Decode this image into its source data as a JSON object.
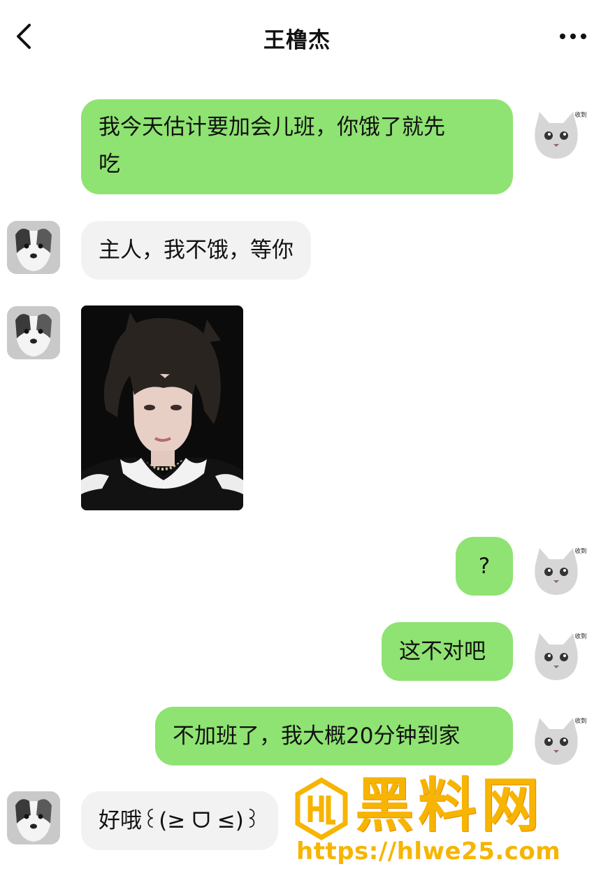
{
  "header": {
    "title": "王橹杰",
    "back_icon": "chevron-left-icon",
    "more_icon": "more-dots-icon"
  },
  "messages": [
    {
      "sender": "me",
      "text": "我今天估计要加会儿班，你饿了就先\n吃"
    },
    {
      "sender": "other",
      "text": "主人，我不饿，等你"
    },
    {
      "sender": "other",
      "type": "image"
    },
    {
      "sender": "me",
      "text": "?"
    },
    {
      "sender": "me",
      "text": "这不对吧"
    },
    {
      "sender": "me",
      "text": "不加班了，我大概20分钟到家"
    },
    {
      "sender": "other",
      "text": "好哦꒰(≥ ᗜ ≤)꒱"
    }
  ],
  "avatars": {
    "me_tag": "收到",
    "me_icon": "cat-avatar-icon",
    "other_icon": "dog-avatar-icon"
  },
  "watermark": {
    "title": "黑料网",
    "url": "https://hlwe25.com",
    "logo_icon": "hl-logo-icon",
    "color": "#f7b400"
  },
  "colors": {
    "my_bubble": "#8fe372",
    "their_bubble": "#f2f2f2"
  }
}
